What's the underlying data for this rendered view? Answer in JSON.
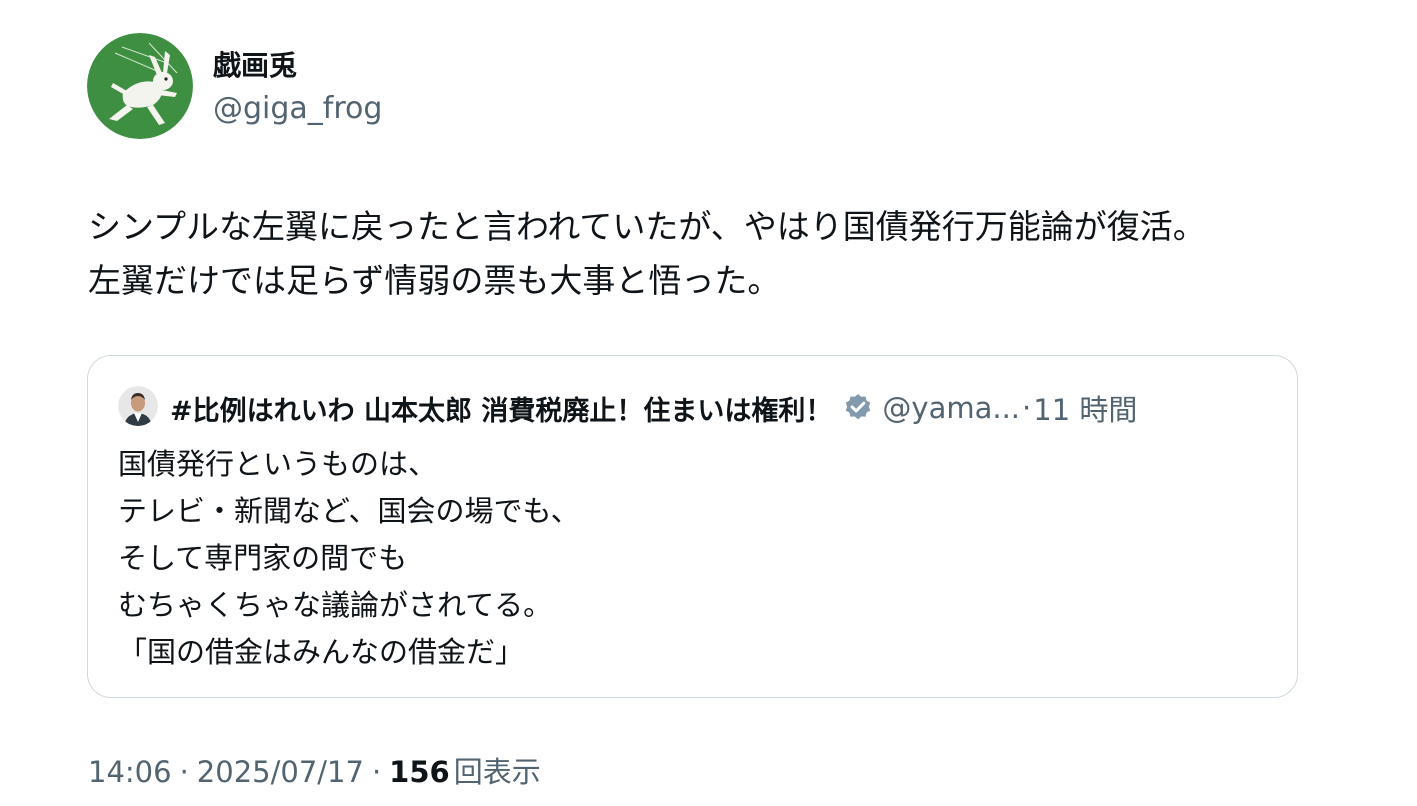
{
  "author": {
    "display_name": "戯画兎",
    "handle": "@giga_frog",
    "avatar_icon": "rabbit-caricature-avatar",
    "avatar_bg_color": "#3e8f42"
  },
  "tweet": {
    "lines": [
      "シンプルな左翼に戻ったと言われていたが、やはり国債発行万能論が復活。",
      "左翼だけでは足らず情弱の票も大事と悟った。"
    ]
  },
  "quote": {
    "display_name": "#比例はれいわ 山本太郎 消費税廃止！住まいは権利！",
    "verified_icon": "verified-badge-icon",
    "verified_color": "#829aab",
    "handle": "@yama...",
    "dot": "·",
    "time": "11 時間",
    "lines": [
      "国債発行というものは、",
      "テレビ・新聞など、国会の場でも、",
      "そして専門家の間でも",
      "むちゃくちゃな議論がされてる。",
      "「国の借金はみんなの借金だ」"
    ]
  },
  "meta": {
    "time": "14:06",
    "sep1": "·",
    "date": "2025/07/17",
    "sep2": "·",
    "views_count": "156",
    "views_label": "回表示"
  },
  "colors": {
    "text_primary": "#0f1419",
    "text_secondary": "#536471",
    "border": "#cfd9de"
  }
}
